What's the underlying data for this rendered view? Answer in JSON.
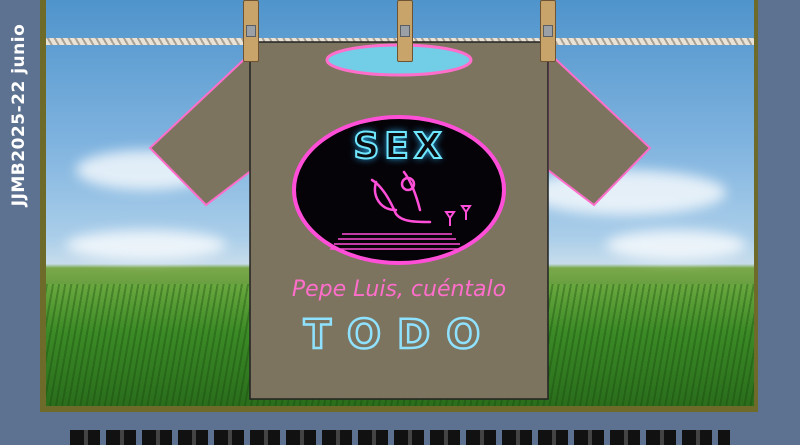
{
  "side_caption": "JJMB2025-22 junio",
  "shirt": {
    "neon_sign": "SEX",
    "line1": "Pepe Luis, cuéntalo",
    "line2": "TODO"
  },
  "colors": {
    "background": "#5d7290",
    "frame": "#6e6a2a",
    "shirt": "#7d745f",
    "shirt_trim": "#ff6ecb",
    "neon_blue": "#6fe8ff",
    "neon_pink": "#ff4fd8"
  }
}
